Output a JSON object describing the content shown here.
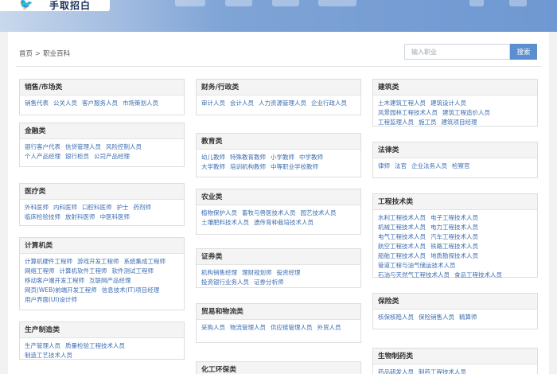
{
  "breadcrumb": {
    "home": "首页",
    "sep": ">",
    "current": "职业百科"
  },
  "search": {
    "placeholder": "输入职业",
    "button": "搜索"
  },
  "columns": [
    [
      {
        "title": "销售/市场类",
        "items": [
          "销售代表",
          "公关人员",
          "客户服务人员",
          "市场策划人员"
        ]
      },
      {
        "title": "金融类",
        "items": [
          "银行客户代表",
          "信贷管理人员",
          "风险控制人员",
          "个人产品经理",
          "银行柜员",
          "公司产品经理"
        ]
      },
      {
        "title": "医疗类",
        "items": [
          "外科医师",
          "内科医师",
          "口腔科医师",
          "护士",
          "药剂师",
          "临床检验技师",
          "放射科医师",
          "中医科医师"
        ]
      },
      {
        "title": "计算机类",
        "items": [
          "计算机硬件工程师",
          "游戏开发工程师",
          "系统集成工程师",
          "网络工程师",
          "计算机软件工程师",
          "软件测试工程师",
          "移动客户端开发工程师",
          "互联网产品经理",
          "网页(WEB)前端开发工程师",
          "信息技术(IT)项目经理",
          "用户界面(UI)设计师"
        ]
      },
      {
        "title": "生产制造类",
        "items": [
          "生产管理人员",
          "质量检验工程技术人员",
          "制造工艺技术人员"
        ]
      }
    ],
    [
      {
        "title": "财务/行政类",
        "items": [
          "审计人员",
          "会计人员",
          "人力资源管理人员",
          "企业行政人员"
        ]
      },
      {
        "title": "教育类",
        "items": [
          "幼儿教师",
          "特殊教育教师",
          "小学教师",
          "中学教师",
          "大学教师",
          "培训机构教师",
          "中等职业学校教师"
        ]
      },
      {
        "title": "农业类",
        "items": [
          "植物保护人员",
          "畜牧与兽医技术人员",
          "园艺技术人员",
          "土壤肥料技术人员",
          "遗传育种栽培技术人员"
        ]
      },
      {
        "title": "证券类",
        "items": [
          "机构销售经理",
          "理财规划师",
          "投资经理",
          "投资银行业务人员",
          "证券分析师"
        ]
      },
      {
        "title": "贸易和物流类",
        "items": [
          "采购人员",
          "物流管理人员",
          "供应链管理人员",
          "外贸人员"
        ]
      },
      {
        "title": "化工环保类",
        "items": []
      }
    ],
    [
      {
        "title": "建筑类",
        "items": [
          "土木建筑工程人员",
          "建筑设计人员",
          "风景园林工程技术人员",
          "建筑工程造价人员",
          "工程监理人员",
          "施工员",
          "建筑项目经理"
        ]
      },
      {
        "title": "法律类",
        "items": [
          "律师",
          "法官",
          "企业法务人员",
          "检察官"
        ]
      },
      {
        "title": "工程技术类",
        "items": [
          "水利工程技术人员",
          "电子工程技术人员",
          "机械工程技术人员",
          "电力工程技术人员",
          "电气工程技术人员",
          "汽车工程技术人员",
          "航空工程技术人员",
          "铁路工程技术人员",
          "船舶工程技术人员",
          "地质勘探技术人员",
          "管道工程与油气储运技术人员",
          "石油与天然气工程技术人员",
          "食品工程技术人员"
        ]
      },
      {
        "title": "保险类",
        "items": [
          "核保核赔人员",
          "保险销售人员",
          "精算师"
        ]
      },
      {
        "title": "生物制药类",
        "items": [
          "药品研发人员",
          "制药工程技术人员"
        ]
      }
    ]
  ]
}
